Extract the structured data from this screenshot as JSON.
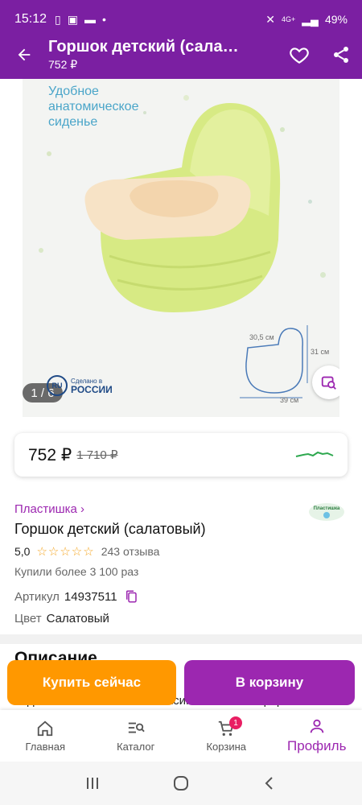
{
  "status_bar": {
    "time": "15:12",
    "network": "4G+",
    "battery": "49%"
  },
  "app_bar": {
    "title": "Горшок детский (сала…",
    "subtitle": "752 ₽"
  },
  "gallery": {
    "promo_text": "Удобное\nанатомическое\nсиденье",
    "counter": "1 / 6",
    "made_in_badge": {
      "circle": "RU",
      "line1": "Сделано в",
      "line2": "РОССИИ"
    },
    "dimensions": {
      "seat": "30,5 см",
      "height": "31 см",
      "length": "39 см"
    }
  },
  "price": {
    "current": "752 ₽",
    "old": "1 710 ₽"
  },
  "product": {
    "brand": "Пластишка ›",
    "brand_logo": "Пластишка",
    "name": "Горшок детский (салатовый)",
    "rating": "5,0",
    "stars": "☆☆☆☆☆",
    "reviews": "243 отзыва",
    "bought": "Купили более 3 100 раз",
    "article_label": "Артикул",
    "article_value": "14937511",
    "color_label": "Цвет",
    "color_value": "Салатовый"
  },
  "description": {
    "title": "Описание",
    "text": "сиденьем обеспечивает максимальный комфорт"
  },
  "actions": {
    "buy_now": "Купить сейчас",
    "add_to_cart": "В корзину"
  },
  "bottom_nav": [
    {
      "label": "Главная",
      "icon": "home-icon"
    },
    {
      "label": "Каталог",
      "icon": "catalog-search-icon"
    },
    {
      "label": "Корзина",
      "icon": "cart-icon",
      "badge": "1"
    },
    {
      "label": "Профиль",
      "icon": "profile-icon",
      "active": true
    }
  ],
  "colors": {
    "primary": "#7b1fa2",
    "accent": "#9c27b0",
    "buy": "#ff9800",
    "star": "#f5a623",
    "potty": "#d7ea84"
  }
}
